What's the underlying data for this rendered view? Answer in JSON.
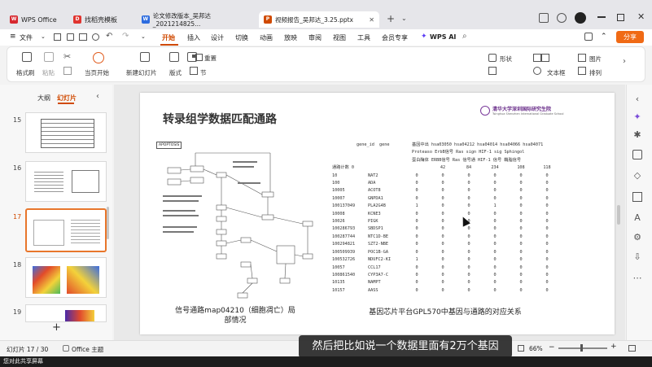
{
  "tabs": [
    {
      "label": "WPS Office",
      "icon": "wps-logo-icon",
      "color": "#d7282f"
    },
    {
      "label": "找稻壳模板",
      "icon": "docer-icon",
      "color": "#e0342f"
    },
    {
      "label": "论文修改版本_吴邦达_2021214825...",
      "icon": "word-doc-icon",
      "color": "#2d6cdf"
    },
    {
      "label": "视频报告_吴邦达_3.25.pptx",
      "icon": "ppt-icon",
      "color": "#d04a02"
    }
  ],
  "menu": {
    "file": "文件",
    "items": [
      "开始",
      "插入",
      "设计",
      "切换",
      "动画",
      "放映",
      "审阅",
      "视图",
      "工具",
      "会员专享"
    ],
    "active": "开始",
    "ai": "WPS AI",
    "share": "分享"
  },
  "ribbon": {
    "format_painter": "格式刷",
    "paste": "粘贴",
    "from_current": "当页开始",
    "new_slide": "新建幻灯片",
    "layout": "版式",
    "section": "节",
    "reset": "重置",
    "shape": "形状",
    "picture": "图片",
    "textbox": "文本框",
    "arrange": "排列"
  },
  "leftpanel": {
    "tab_outline": "大纲",
    "tab_slides": "幻灯片",
    "thumbs": [
      {
        "num": "15",
        "selected": false
      },
      {
        "num": "16",
        "selected": false
      },
      {
        "num": "17",
        "selected": true
      },
      {
        "num": "18",
        "selected": false
      },
      {
        "num": "19",
        "selected": false
      }
    ],
    "add": "+"
  },
  "slide": {
    "title": "转录组学数据匹配通路",
    "logo_text": "清华大学深圳国际研究生院",
    "logo_sub": "Tsinghua Shenzhen International Graduate School",
    "left_caption": "信号通路map04210（细胞凋亡）局部情况",
    "right_caption": "基因芯片平台GPL570中基因与通路的对应关系",
    "pathway_box_label": "APOPTOSIS",
    "table": {
      "header_gene_id": "gene_id",
      "header_gene": "gene",
      "header_pathways": "基因中出 hsa03050 hsa04212 hsa04014 hsa04066 hsa04071",
      "header_line2": "Proteaso ErbB信号 Ras sign HIF-1 sig Sphingol",
      "header_line3": "蛋白酶体 ERBB信号 Ras 信号通 HIF-1 信号 鞘脂信号",
      "counts_label": "通路计数 0",
      "counts": [
        "42",
        "84",
        "234",
        "108",
        "118"
      ],
      "rows": [
        {
          "id": "10",
          "gene": "NAT2",
          "vals": [
            "0",
            "0",
            "0",
            "0",
            "0",
            "0"
          ]
        },
        {
          "id": "100",
          "gene": "ADA",
          "vals": [
            "0",
            "0",
            "0",
            "0",
            "0",
            "0"
          ]
        },
        {
          "id": "10005",
          "gene": "ACOT8",
          "vals": [
            "0",
            "0",
            "0",
            "0",
            "0",
            "0"
          ]
        },
        {
          "id": "10007",
          "gene": "GNPDA1",
          "vals": [
            "0",
            "0",
            "0",
            "0",
            "0",
            "0"
          ]
        },
        {
          "id": "100137049",
          "gene": "PLA2G4B",
          "vals": [
            "1",
            "0",
            "0",
            "1",
            "0",
            "0"
          ]
        },
        {
          "id": "10008",
          "gene": "KCNE3",
          "vals": [
            "0",
            "0",
            "0",
            "0",
            "0",
            "0"
          ]
        },
        {
          "id": "10026",
          "gene": "PIGK",
          "vals": [
            "0",
            "0",
            "0",
            "0",
            "0",
            "0"
          ]
        },
        {
          "id": "100286793",
          "gene": "SBDSP1",
          "vals": [
            "0",
            "0",
            "0",
            "0",
            "0",
            "0"
          ]
        },
        {
          "id": "100287744",
          "gene": "NTC1D-BE",
          "vals": [
            "0",
            "0",
            "0",
            "0",
            "0",
            "0"
          ]
        },
        {
          "id": "100294821",
          "gene": "SZT2-NBE",
          "vals": [
            "0",
            "0",
            "0",
            "0",
            "0",
            "0"
          ]
        },
        {
          "id": "100509939",
          "gene": "POC1B-GA",
          "vals": [
            "0",
            "0",
            "0",
            "0",
            "0",
            "0"
          ]
        },
        {
          "id": "100532726",
          "gene": "NDUFC2-KI",
          "vals": [
            "1",
            "0",
            "0",
            "0",
            "0",
            "0"
          ]
        },
        {
          "id": "10057",
          "gene": "CCL17",
          "vals": [
            "0",
            "0",
            "0",
            "0",
            "0",
            "0"
          ]
        },
        {
          "id": "100861540",
          "gene": "CYP3A7-C",
          "vals": [
            "0",
            "0",
            "0",
            "0",
            "0",
            "0"
          ]
        },
        {
          "id": "10135",
          "gene": "NAMPT",
          "vals": [
            "0",
            "0",
            "0",
            "0",
            "0",
            "0"
          ]
        },
        {
          "id": "10157",
          "gene": "AASS",
          "vals": [
            "0",
            "0",
            "0",
            "0",
            "0",
            "0"
          ]
        }
      ]
    }
  },
  "status": {
    "slide_counter": "幻灯片 17 / 30",
    "theme": "Office 主题",
    "zoom": "66%"
  },
  "subtitle": "然后把比如说一个数据里面有2万个基因",
  "bottombar": "您对此共享屏幕"
}
